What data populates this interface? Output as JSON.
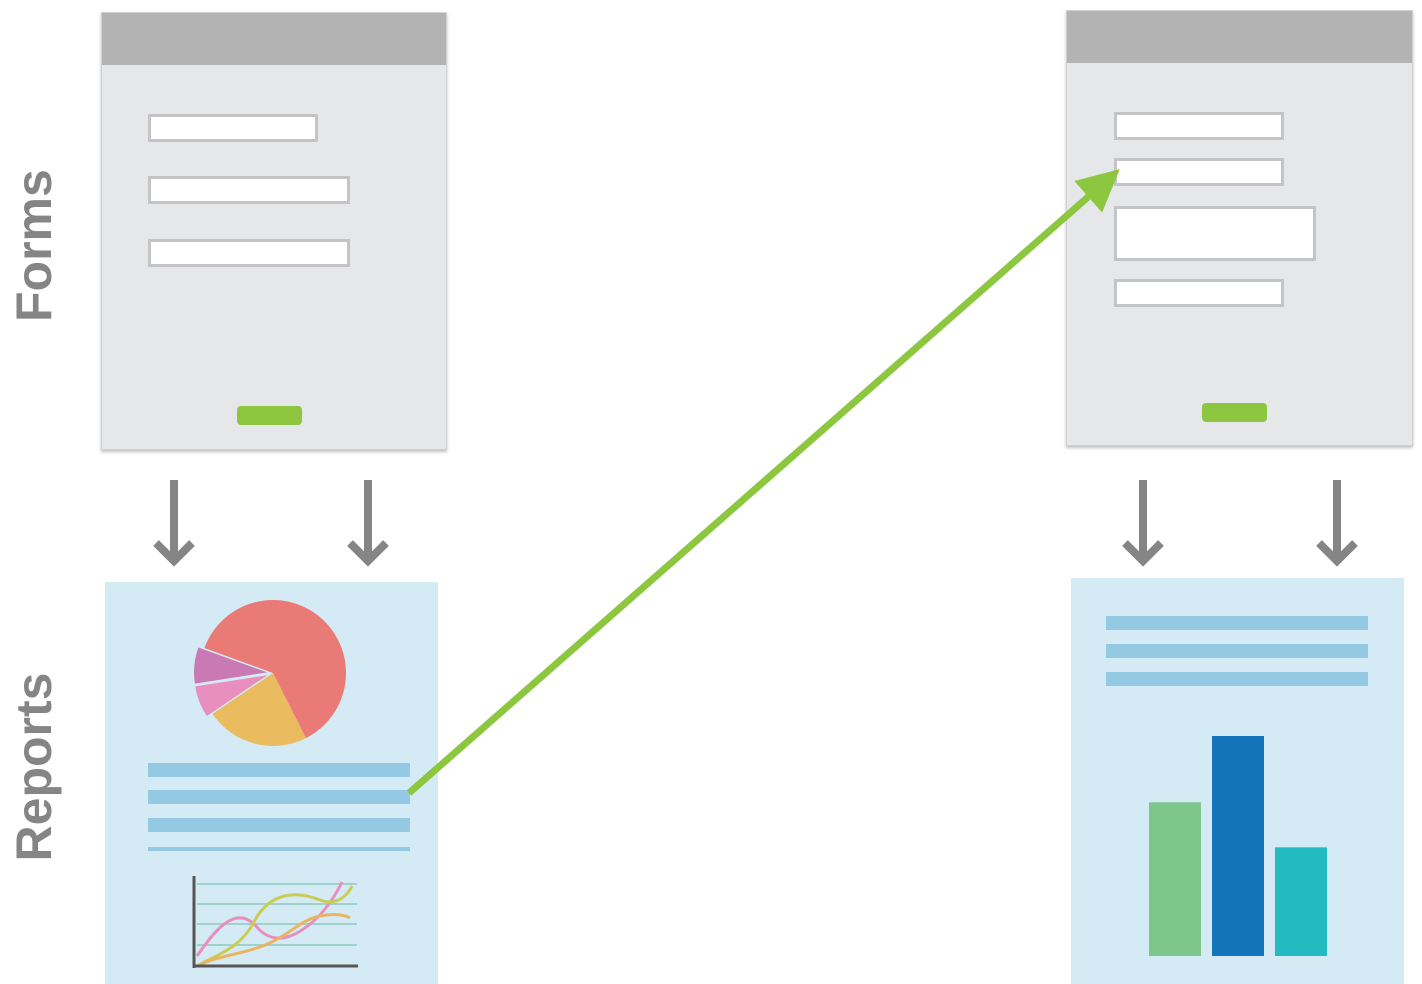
{
  "labels": {
    "forms": "Forms",
    "reports": "Reports"
  },
  "colors": {
    "window_body": "#e6e7e9",
    "title_bar": "#b3b3b3",
    "submit_button": "#8dc63f",
    "report_background": "#d4ebf5",
    "text_lines": "#94c9e4",
    "arrows": "#858585",
    "connector": "#8dc63f"
  },
  "left_report_pie": {
    "slices": [
      {
        "name": "salmon",
        "color": "#ea7a76",
        "share": 0.62
      },
      {
        "name": "yellow",
        "color": "#ebbb60",
        "share": 0.23
      },
      {
        "name": "pink",
        "color": "#e88fbd",
        "share": 0.07
      },
      {
        "name": "purple",
        "color": "#c979b3",
        "share": 0.08
      }
    ]
  },
  "right_report_bars": {
    "values": [
      58,
      83,
      41
    ],
    "colors": [
      "#7dc78b",
      "#1474ba",
      "#23bac2"
    ]
  },
  "left_report_lines": {
    "colors": [
      "#e98fbe",
      "#c9cd53",
      "#eab563"
    ]
  }
}
